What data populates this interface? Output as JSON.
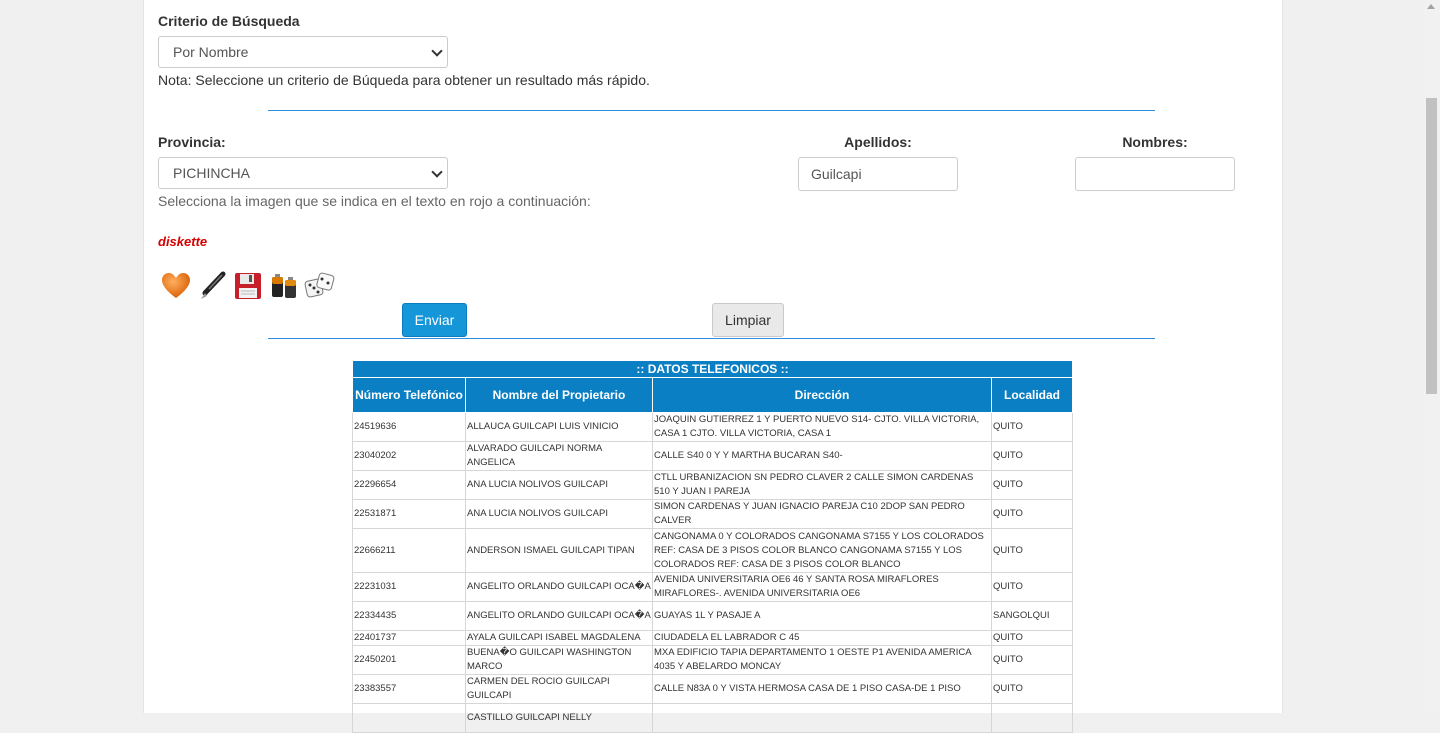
{
  "search": {
    "criteria_label": "Criterio de Búsqueda",
    "criteria_value": "Por Nombre",
    "note": "Nota: Seleccione un criterio de Búqueda para obtener un resultado más rápido."
  },
  "form": {
    "province_label": "Provincia:",
    "province_value": "PICHINCHA",
    "surnames_label": "Apellidos:",
    "surnames_value": "Guilcapi",
    "names_label": "Nombres:",
    "names_value": ""
  },
  "captcha": {
    "instruction": "Selecciona la imagen que se indica en el texto en rojo a continuación:",
    "target_word": "diskette",
    "icons": [
      "heart-icon",
      "pen-icon",
      "diskette-icon",
      "battery-icon",
      "dice-icon"
    ]
  },
  "buttons": {
    "submit": "Enviar",
    "clear": "Limpiar"
  },
  "results": {
    "caption": ":: DATOS TELEFONICOS ::",
    "headers": [
      "Número Telefónico",
      "Nombre del Propietario",
      "Dirección",
      "Localidad"
    ],
    "rows": [
      [
        "24519636",
        "ALLAUCA GUILCAPI LUIS VINICIO",
        "JOAQUIN GUTIERREZ 1 Y PUERTO NUEVO S14- CJTO. VILLA VICTORIA, CASA 1 CJTO. VILLA VICTORIA, CASA 1",
        "QUITO"
      ],
      [
        "23040202",
        "ALVARADO GUILCAPI NORMA ANGELICA",
        "CALLE S40 0 Y Y MARTHA BUCARAN S40-",
        "QUITO"
      ],
      [
        "22296654",
        "ANA LUCIA NOLIVOS GUILCAPI",
        "CTLL URBANIZACION SN PEDRO CLAVER 2 CALLE SIMON CARDENAS 510 Y JUAN I PAREJA",
        "QUITO"
      ],
      [
        "22531871",
        "ANA LUCIA NOLIVOS GUILCAPI",
        "SIMON CARDENAS Y JUAN IGNACIO PAREJA C10 2DOP SAN PEDRO CALVER",
        "QUITO"
      ],
      [
        "22666211",
        "ANDERSON ISMAEL GUILCAPI TIPAN",
        "CANGONAMA 0 Y COLORADOS CANGONAMA S7155 Y LOS COLORADOS REF: CASA DE 3 PISOS COLOR BLANCO CANGONAMA S7155 Y LOS COLORADOS REF: CASA DE 3 PISOS COLOR BLANCO",
        "QUITO"
      ],
      [
        "22231031",
        "ANGELITO ORLANDO GUILCAPI OCA�A",
        "AVENIDA UNIVERSITARIA OE6 46 Y SANTA ROSA MIRAFLORES MIRAFLORES-. AVENIDA UNIVERSITARIA OE6",
        "QUITO"
      ],
      [
        "22334435",
        "ANGELITO ORLANDO GUILCAPI OCA�A",
        "GUAYAS 1L Y PASAJE A",
        "SANGOLQUI"
      ],
      [
        "22401737",
        "AYALA GUILCAPI ISABEL MAGDALENA",
        "CIUDADELA EL LABRADOR C 45",
        "QUITO"
      ],
      [
        "22450201",
        "BUENA�O GUILCAPI WASHINGTON MARCO",
        "MXA EDIFICIO TAPIA DEPARTAMENTO 1 OESTE P1 AVENIDA AMERICA 4035 Y ABELARDO MONCAY",
        "QUITO"
      ],
      [
        "23383557",
        "CARMEN DEL ROCIO GUILCAPI GUILCAPI",
        "CALLE N83A 0 Y VISTA HERMOSA CASA DE 1 PISO CASA-DE 1 PISO",
        "QUITO"
      ],
      [
        "",
        "CASTILLO GUILCAPI NELLY",
        "",
        ""
      ]
    ]
  }
}
